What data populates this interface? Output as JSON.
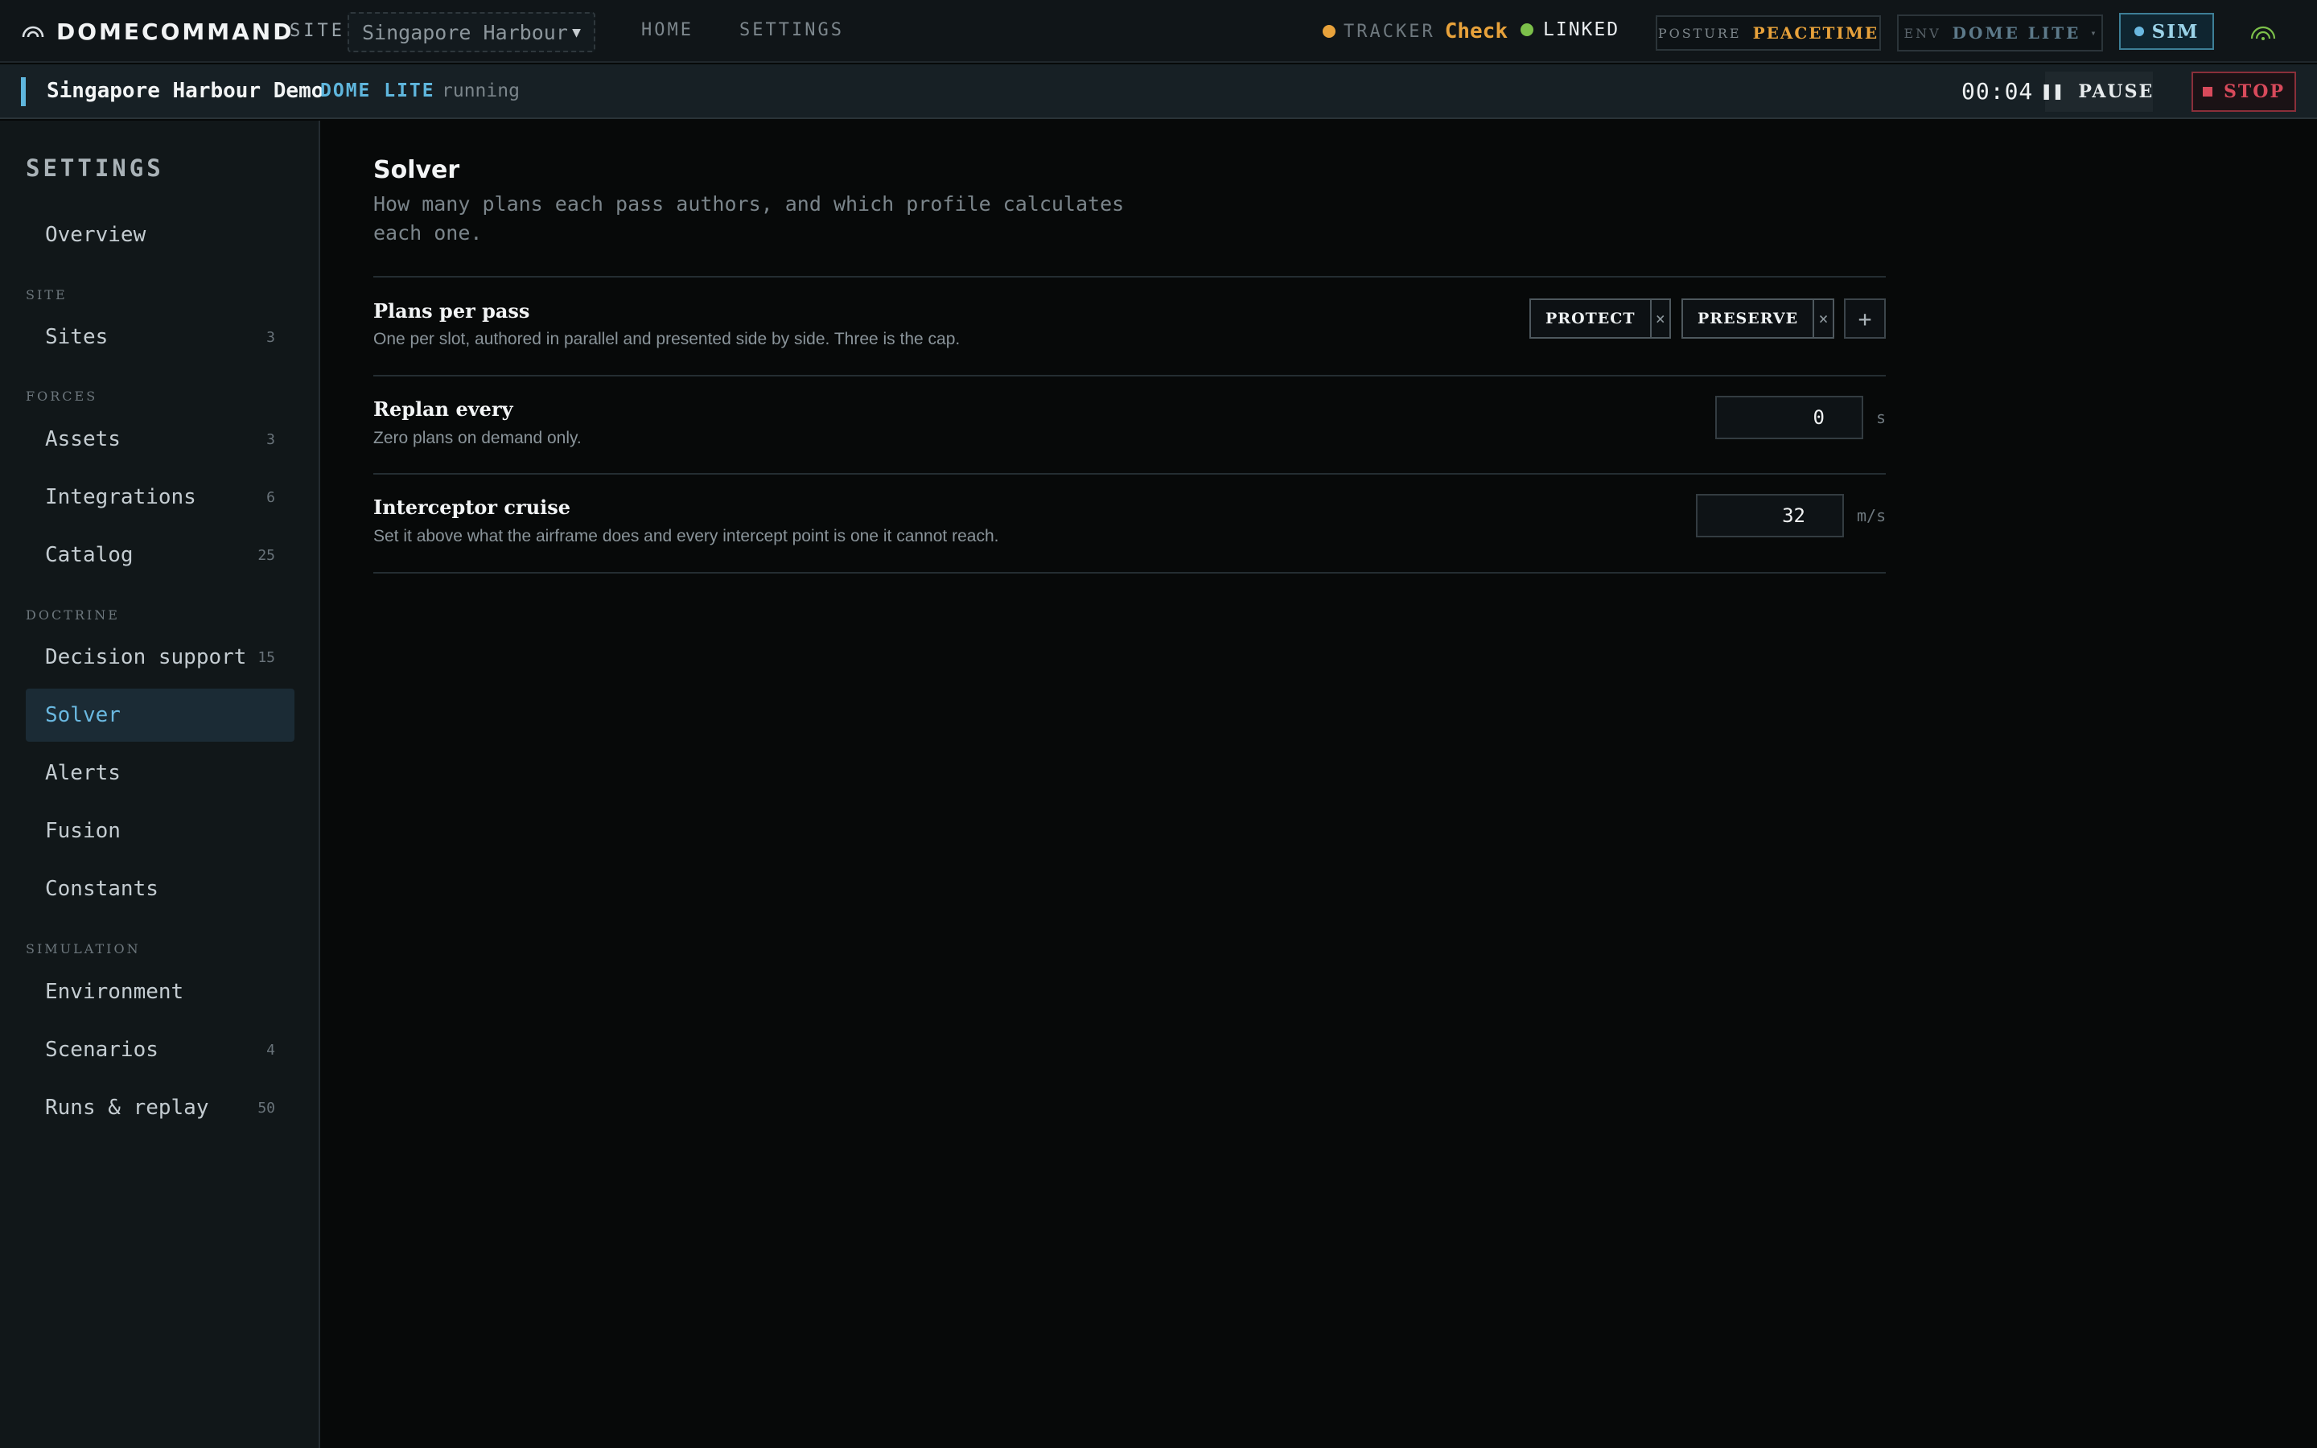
{
  "app": {
    "brand": "DOMECOMMAND",
    "site_label": "SITE",
    "site_value": "Singapore Harbour",
    "nav": {
      "home": "HOME",
      "settings": "SETTINGS"
    },
    "tracker": {
      "label": "TRACKER",
      "value": "Check",
      "color": "#e8a23b"
    },
    "link_status": {
      "label": "LINKED",
      "color": "#7cc04a"
    },
    "posture": {
      "label": "POSTURE",
      "value": "PEACETIME"
    },
    "env": {
      "label": "ENV",
      "value": "DOME LITE",
      "caret": "▾"
    },
    "sim": {
      "label": "SIM"
    }
  },
  "run": {
    "name": "Singapore Harbour Demo",
    "env": "DOME LITE",
    "status": "running",
    "timer": "00:04",
    "pause_label": "PAUSE",
    "stop_label": "STOP"
  },
  "sidebar": {
    "title": "SETTINGS",
    "overview": "Overview",
    "sections": {
      "site": "SITE",
      "forces": "FORCES",
      "doctrine": "DOCTRINE",
      "simulation": "SIMULATION"
    },
    "items": [
      {
        "label": "Sites",
        "count": "3"
      },
      {
        "label": "Assets",
        "count": "3"
      },
      {
        "label": "Integrations",
        "count": "6"
      },
      {
        "label": "Catalog",
        "count": "25"
      },
      {
        "label": "Decision support",
        "count": "15"
      },
      {
        "label": "Solver",
        "count": ""
      },
      {
        "label": "Alerts",
        "count": ""
      },
      {
        "label": "Fusion",
        "count": ""
      },
      {
        "label": "Constants",
        "count": ""
      },
      {
        "label": "Environment",
        "count": ""
      },
      {
        "label": "Scenarios",
        "count": "4"
      },
      {
        "label": "Runs & replay",
        "count": "50"
      }
    ],
    "active": "Solver"
  },
  "page": {
    "title": "Solver",
    "description": "How many plans each pass authors, and which profile calculates each one.",
    "rows": [
      {
        "title": "Plans per pass",
        "description": "One per slot, authored in parallel and presented side by side. Three is the cap.",
        "chips": [
          "PROTECT",
          "PRESERVE"
        ],
        "remove_glyph": "×",
        "add_glyph": "+"
      },
      {
        "title": "Replan every",
        "description": "Zero plans on demand only.",
        "value": "0",
        "unit": "s"
      },
      {
        "title": "Interceptor cruise",
        "description": "Set it above what the airframe does and every intercept point is one it cannot reach.",
        "value": "32",
        "unit": "m/s"
      }
    ]
  }
}
